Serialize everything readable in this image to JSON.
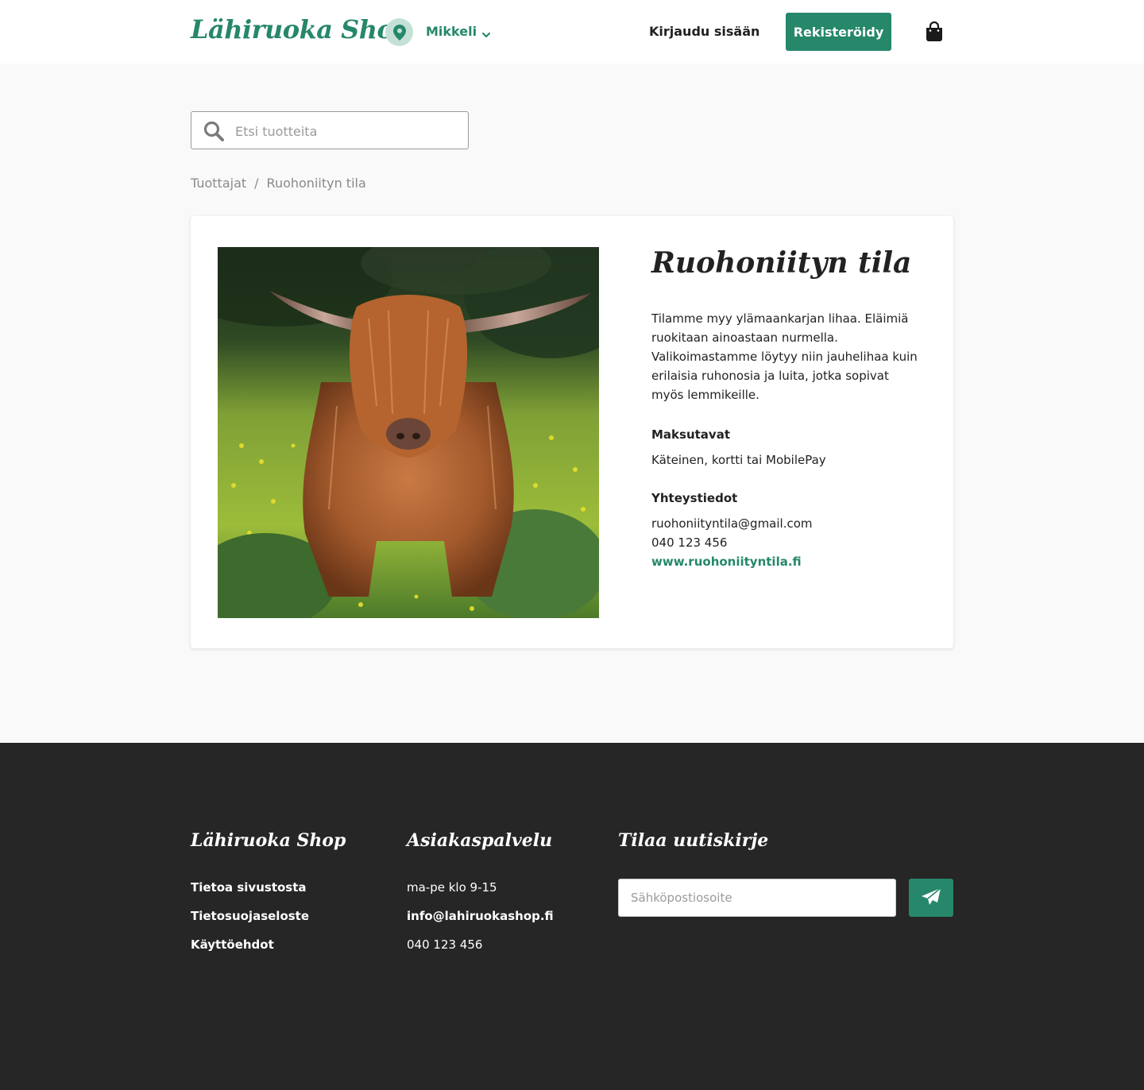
{
  "header": {
    "logo": "Lähiruoka Shop",
    "location": "Mikkeli",
    "login_label": "Kirjaudu sisään",
    "register_label": "Rekisteröidy"
  },
  "search": {
    "placeholder": "Etsi tuotteita"
  },
  "breadcrumb": {
    "items": [
      "Tuottajat",
      "Ruohoniityn tila"
    ],
    "separator": "/"
  },
  "producer": {
    "name": "Ruohoniityn tila",
    "description": "Tilamme myy ylämaankarjan lihaa. Eläimiä ruokitaan ainoastaan nurmella. Valikoimastamme löytyy niin jauhelihaa kuin erilaisia ruhonosia ja luita, jotka sopivat myös lemmikeille.",
    "payment_heading": "Maksutavat",
    "payment_methods": "Käteinen, kortti tai MobilePay",
    "contact_heading": "Yhteystiedot",
    "email": "ruohoniityntila@gmail.com",
    "phone": "040 123 456",
    "website": "www.ruohoniityntila.fi"
  },
  "footer": {
    "col1": {
      "heading": "Lähiruoka Shop",
      "links": [
        "Tietoa sivustosta",
        "Tietosuojaseloste",
        "Käyttöehdot"
      ]
    },
    "col2": {
      "heading": "Asiakaspalvelu",
      "hours": "ma-pe klo 9-15",
      "email": "info@lahiruokashop.fi",
      "phone": "040 123 456"
    },
    "col3": {
      "heading": "Tilaa uutiskirje",
      "email_placeholder": "Sähköpostiosoite"
    }
  },
  "colors": {
    "accent": "#26876b",
    "footer_bg": "#262626",
    "page_bg": "#f9f9f9"
  },
  "icons": [
    "location-pin-icon",
    "chevron-down-icon",
    "shopping-bag-icon",
    "search-icon",
    "send-icon"
  ]
}
